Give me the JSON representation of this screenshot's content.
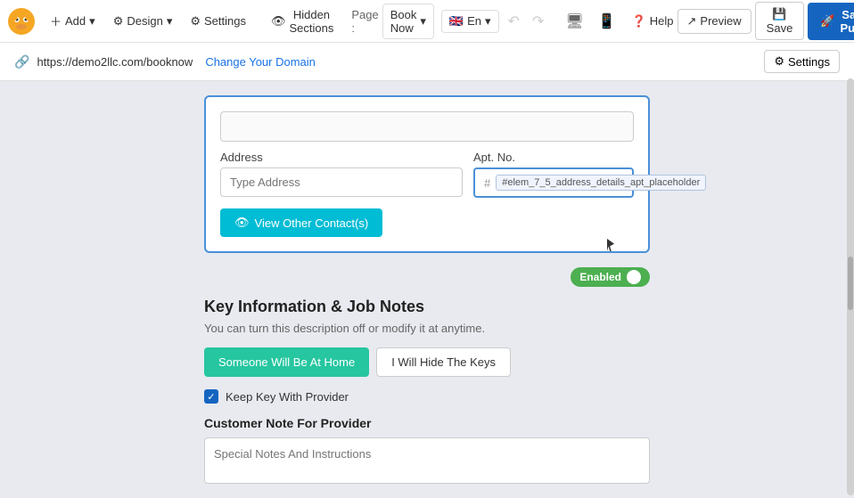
{
  "toolbar": {
    "add_label": "Add",
    "design_label": "Design",
    "settings_label": "Settings",
    "hidden_sections_label": "Hidden Sections",
    "page_label": "Page :",
    "page_name": "Book Now",
    "lang_code": "En",
    "help_label": "Help",
    "preview_label": "Preview",
    "save_label": "Save",
    "save_publish_label": "Save & Publish"
  },
  "url_bar": {
    "url": "https://demo2llc.com/booknow",
    "change_domain_label": "Change Your Domain",
    "settings_label": "Settings"
  },
  "address_section": {
    "address_label": "Address",
    "address_placeholder": "Type Address",
    "apt_label": "Apt. No.",
    "apt_placeholder": "#elem_7_5_address_details_apt_placeholder",
    "apt_hash": "#",
    "view_contacts_label": "View Other Contact(s)"
  },
  "key_info": {
    "enabled_label": "Enabled",
    "title": "Key Information & Job Notes",
    "description": "You can turn this description off or modify it at anytime.",
    "btn_someone_home": "Someone Will Be At Home",
    "btn_hide_keys": "I Will Hide The Keys",
    "checkbox_label": "Keep Key With Provider",
    "customer_note_title": "Customer Note For Provider",
    "note_placeholder": "Special Notes And Instructions"
  }
}
